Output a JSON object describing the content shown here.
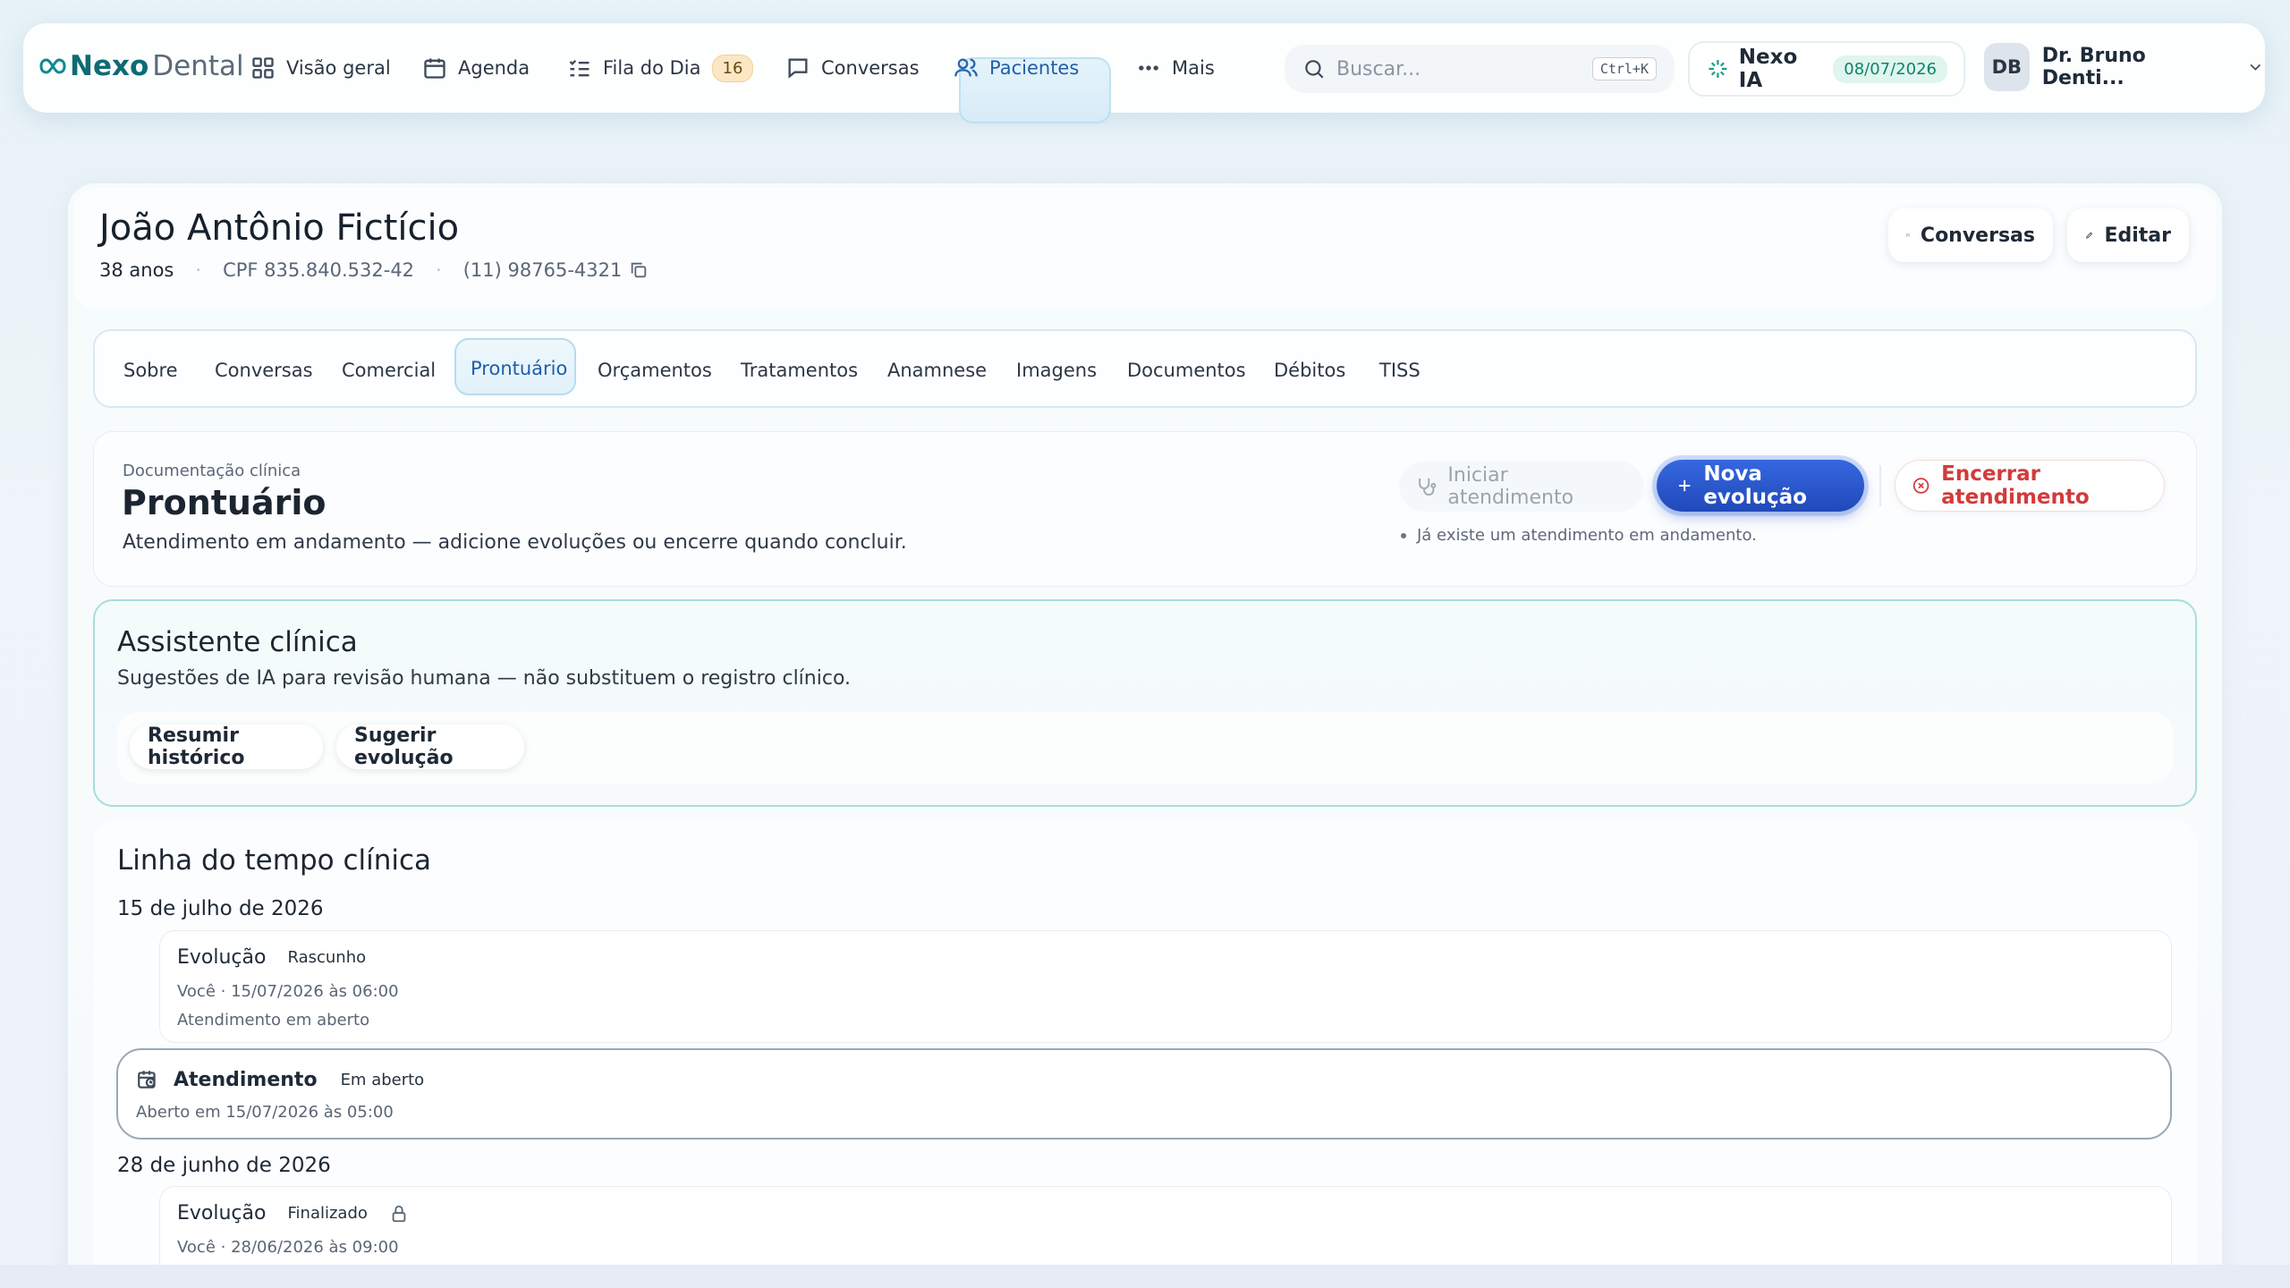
{
  "brand": {
    "part1": "Nexo",
    "part2": "Dental"
  },
  "nav": {
    "items": [
      {
        "label": "Visão geral",
        "icon": "grid-icon"
      },
      {
        "label": "Agenda",
        "icon": "calendar-icon"
      },
      {
        "label": "Fila do Dia",
        "icon": "list-check-icon",
        "badge": "16"
      },
      {
        "label": "Conversas",
        "icon": "chat-icon"
      },
      {
        "label": "Pacientes",
        "icon": "users-icon",
        "active": true
      },
      {
        "label": "Mais",
        "icon": "more-dots-icon"
      }
    ],
    "search": {
      "placeholder": "Buscar...",
      "shortcut": "Ctrl+K"
    },
    "ia": {
      "label": "Nexo IA",
      "date": "08/07/2026"
    },
    "user": {
      "initials": "DB",
      "name": "Dr. Bruno Denti..."
    }
  },
  "patient": {
    "name": "João Antônio Fictício",
    "age": "38 anos",
    "cpf": "CPF 835.840.532-42",
    "phone": "(11) 98765-4321",
    "actions": {
      "conversas": "Conversas",
      "editar": "Editar"
    }
  },
  "tabs": [
    "Sobre",
    "Conversas",
    "Comercial",
    "Prontuário",
    "Orçamentos",
    "Tratamentos",
    "Anamnese",
    "Imagens",
    "Documentos",
    "Débitos",
    "TISS"
  ],
  "active_tab": "Prontuário",
  "prontuario": {
    "kicker": "Documentação clínica",
    "title": "Prontuário",
    "subtitle": "Atendimento em andamento — adicione evoluções ou encerre quando concluir.",
    "btn_iniciar": "Iniciar atendimento",
    "btn_nova": "Nova evolução",
    "btn_encerrar": "Encerrar atendimento",
    "note": "Já existe um atendimento em andamento."
  },
  "assistente": {
    "title": "Assistente clínica",
    "subtitle": "Sugestões de IA para revisão humana — não substituem o registro clínico.",
    "chips": [
      "Resumir histórico",
      "Sugerir evolução"
    ]
  },
  "timeline": {
    "title": "Linha do tempo clínica",
    "groups": [
      {
        "date": "15 de julho de 2026",
        "evolucao": {
          "type": "Evolução",
          "status": "Rascunho",
          "meta": "Você · 15/07/2026 às 06:00",
          "detail": "Atendimento em aberto"
        },
        "atendimento": {
          "type": "Atendimento",
          "status": "Em aberto",
          "meta": "Aberto em 15/07/2026 às 05:00"
        }
      },
      {
        "date": "28 de junho de 2026",
        "evolucao": {
          "type": "Evolução",
          "status": "Finalizado",
          "meta": "Você · 28/06/2026 às 09:00"
        }
      }
    ]
  },
  "colors": {
    "accent": "#2d5bd6",
    "danger": "#d23b3b",
    "brand": "#0d6b73",
    "assist_border": "#a9dcdc"
  }
}
